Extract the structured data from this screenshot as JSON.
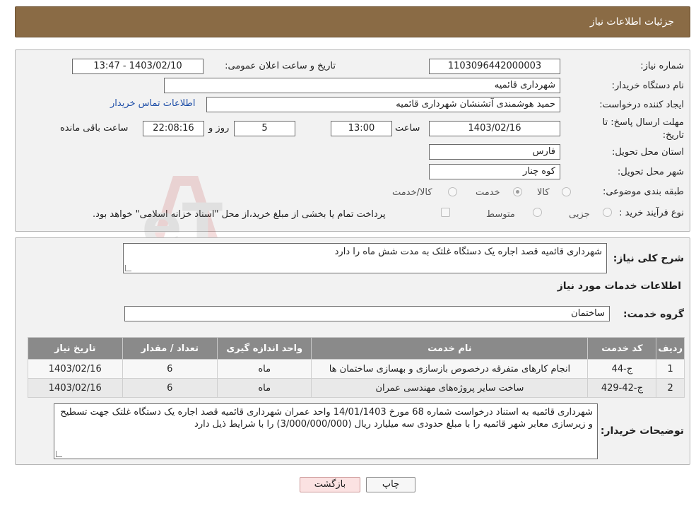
{
  "header": {
    "title": "جزئیات اطلاعات نیاز"
  },
  "details": {
    "need_number_label": "شماره نیاز:",
    "need_number": "1103096442000003",
    "announce_label": "تاریخ و ساعت اعلان عمومی:",
    "announce_value": "1403/02/10 - 13:47",
    "buyer_org_label": "نام دستگاه خریدار:",
    "buyer_org": "شهرداری قائمیه",
    "creator_label": "ایجاد کننده درخواست:",
    "creator": "حمید هوشمندی آتشنشان شهرداری قائمیه",
    "contact_link": "اطلاعات تماس خریدار",
    "deadline_label_1": "مهلت ارسال پاسخ: تا",
    "deadline_label_2": "تاریخ:",
    "deadline_date": "1403/02/16",
    "time_label": "ساعت",
    "deadline_time": "13:00",
    "days_value": "5",
    "days_label": "روز و",
    "remaining_time": "22:08:16",
    "remaining_label": "ساعت باقی مانده",
    "province_label": "استان محل تحویل:",
    "province": "فارس",
    "city_label": "شهر محل تحویل:",
    "city": "کوه چنار",
    "category_label": "طبقه بندی موضوعی:",
    "category_options": [
      "کالا",
      "خدمت",
      "کالا/خدمت"
    ],
    "category_selected": "خدمت",
    "process_label": "نوع فرآیند خرید :",
    "process_options": [
      "جزیی",
      "متوسط"
    ],
    "payment_note": "پرداخت تمام یا بخشی از مبلغ خرید،از محل \"اسناد خزانه اسلامی\" خواهد بود."
  },
  "description": {
    "summary_label": "شرح کلی نیاز:",
    "summary": "شهرداری قائمیه قصد اجاره یک دستگاه غلتک به مدت شش ماه را دارد",
    "services_heading": "اطلاعات خدمات مورد نیاز",
    "service_group_label": "گروه خدمت:",
    "service_group": "ساختمان"
  },
  "table": {
    "headers": [
      "ردیف",
      "کد خدمت",
      "نام خدمت",
      "واحد اندازه گیری",
      "تعداد / مقدار",
      "تاریخ نیاز"
    ],
    "rows": [
      [
        "1",
        "ج-44",
        "انجام کارهای متفرقه درخصوص بازسازی و بهسازی ساختمان ها",
        "ماه",
        "6",
        "1403/02/16"
      ],
      [
        "2",
        "ج-42-429",
        "ساخت سایر پروژه‌های مهندسی عمران",
        "ماه",
        "6",
        "1403/02/16"
      ]
    ]
  },
  "buyer_notes": {
    "label": "توضیحات خریدار:",
    "text": "شهرداری قائمیه  به استناد درخواست شماره 68  مورخ  14/01/1403  واحد عمران شهرداری قائمیه  قصد اجاره یک دستگاه غلتک جهت تسطیح و زیرسازی معابر شهر قائمیه را با مبلغ  حدودی  سه میلیارد ریال  (3/000/000/000)  را  با شرایط ذیل دارد"
  },
  "buttons": {
    "print": "چاپ",
    "back": "بازگشت"
  },
  "watermark": {
    "text": "AriaTender.neT"
  },
  "colors": {
    "header_bg": "#8a6b45",
    "table_header_bg": "#8a8a8a",
    "link": "#1f4fa8"
  }
}
